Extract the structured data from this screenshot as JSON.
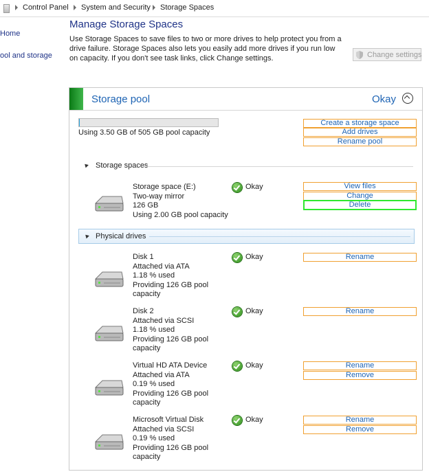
{
  "breadcrumb": {
    "items": [
      "Control Panel",
      "System and Security",
      "Storage Spaces"
    ]
  },
  "left_nav": {
    "items": [
      "Home",
      "ool and storage"
    ]
  },
  "page": {
    "title": "Manage Storage Spaces",
    "description": "Use Storage Spaces to save files to two or more drives to help protect you from a drive failure. Storage Spaces also lets you easily add more drives if you run low on capacity. If you don't see task links, click Change settings.",
    "change_settings": "Change settings"
  },
  "pool": {
    "title": "Storage pool",
    "status": "Okay",
    "capacity_text": "Using 3.50 GB of 505 GB pool capacity",
    "capacity_used_fraction": 0.007,
    "actions": [
      "Create a storage space",
      "Add drives",
      "Rename pool"
    ]
  },
  "storage_spaces": {
    "header": "Storage spaces",
    "items": [
      {
        "name": "Storage space (E:)",
        "type": "Two-way mirror",
        "size": "126 GB",
        "usage": "Using 2.00 GB pool capacity",
        "status": "Okay",
        "actions": [
          "View files",
          "Change",
          "Delete"
        ]
      }
    ]
  },
  "physical_drives": {
    "header": "Physical drives",
    "items": [
      {
        "name": "Disk 1",
        "attached": "Attached via ATA",
        "used": "1.18 % used",
        "providing": "Providing 126 GB pool",
        "providing2": "capacity",
        "status": "Okay",
        "actions": [
          "Rename"
        ]
      },
      {
        "name": "Disk 2",
        "attached": "Attached via SCSI",
        "used": "1.18 % used",
        "providing": "Providing 126 GB pool",
        "providing2": "capacity",
        "status": "Okay",
        "actions": [
          "Rename"
        ]
      },
      {
        "name": "Virtual HD ATA Device",
        "attached": "Attached via ATA",
        "used": "0.19 % used",
        "providing": "Providing 126 GB pool",
        "providing2": "capacity",
        "status": "Okay",
        "actions": [
          "Rename",
          "Remove"
        ]
      },
      {
        "name": "Microsoft Virtual Disk",
        "attached": "Attached via SCSI",
        "used": "0.19 % used",
        "providing": "Providing 126 GB pool",
        "providing2": "capacity",
        "status": "Okay",
        "actions": [
          "Rename",
          "Remove"
        ]
      }
    ]
  },
  "colors": {
    "link": "#1e64b4",
    "title": "#1e3287",
    "pool_accent": "#0b7a16",
    "action_border": "#f0a030",
    "highlight": "#2ee82e"
  }
}
